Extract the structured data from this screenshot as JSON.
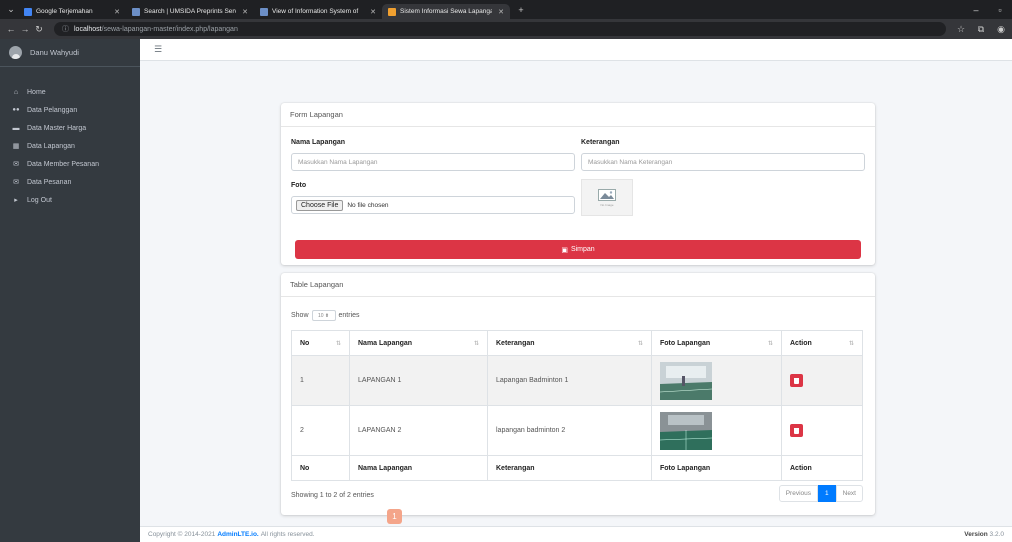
{
  "browser": {
    "tabs": [
      {
        "label": "Google Terjemahan",
        "fav": "#4285f4",
        "active": false
      },
      {
        "label": "Search | UMSIDA Preprints Serv",
        "fav": "#6c8fc7",
        "active": false
      },
      {
        "label": "View of Information System of",
        "fav": "#6c8fc7",
        "active": false
      },
      {
        "label": "Sistem Informasi Sewa Lapangan",
        "fav": "#f0a030",
        "active": true
      }
    ],
    "new_tab": "+",
    "url_host": "localhost",
    "url_path": "/sewa-lapangan-master/index.php/lapangan"
  },
  "sidebar": {
    "user_name": "Danu Wahyudi",
    "items": [
      {
        "label": "Home",
        "icon": "home-icon",
        "glyph": "⌂"
      },
      {
        "label": "Data Pelanggan",
        "icon": "users-icon",
        "glyph": "👥"
      },
      {
        "label": "Data Master Harga",
        "icon": "money-icon",
        "glyph": "▬"
      },
      {
        "label": "Data Lapangan",
        "icon": "grid-icon",
        "glyph": "▦"
      },
      {
        "label": "Data Member Pesanan",
        "icon": "envelope-icon",
        "glyph": "✉"
      },
      {
        "label": "Data Pesanan",
        "icon": "envelope-icon",
        "glyph": "✉"
      },
      {
        "label": "Log Out",
        "icon": "caret-right-icon",
        "glyph": "▸"
      }
    ]
  },
  "form": {
    "title": "Form Lapangan",
    "nama_label": "Nama Lapangan",
    "nama_placeholder": "Masukkan Nama Lapangan",
    "keterangan_label": "Keterangan",
    "keterangan_placeholder": "Masukkan Nama Keterangan",
    "foto_label": "Foto",
    "file_button": "Choose File",
    "file_status": "No file chosen",
    "no_image_text": "No Image",
    "save_label": "Simpan"
  },
  "table_card": {
    "title": "Table Lapangan",
    "show_label": "Show",
    "entries_value": "10",
    "entries_label": "entries",
    "columns": [
      "No",
      "Nama Lapangan",
      "Keterangan",
      "Foto Lapangan",
      "Action"
    ],
    "rows": [
      {
        "no": "1",
        "nama": "LAPANGAN 1",
        "keterangan": "Lapangan Badminton 1"
      },
      {
        "no": "2",
        "nama": "LAPANGAN 2",
        "keterangan": "lapangan badminton 2"
      }
    ],
    "info": "Showing 1 to 2 of 2 entries",
    "prev": "Previous",
    "page": "1",
    "next": "Next"
  },
  "footer": {
    "copyright_prefix": "Copyright © 2014-2021",
    "brand": "AdminLTE.io.",
    "rights": "All rights reserved.",
    "version_label": "Version",
    "version_value": "3.2.0"
  },
  "notification_count": "1",
  "colors": {
    "sidebar": "#343a40",
    "danger": "#dc3545",
    "primary": "#007bff"
  }
}
